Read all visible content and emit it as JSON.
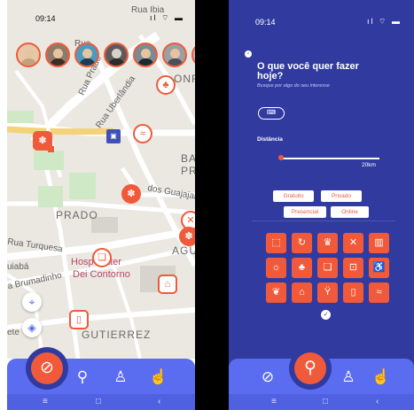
{
  "colors": {
    "accent": "#f05a3a",
    "primary": "#313b9f",
    "nav": "#5a6cf0"
  },
  "map_screen": {
    "status": {
      "time": "09:14",
      "icons": "ıl ⌔ ▬"
    },
    "street_labels": {
      "rua_ibia": "Rua Ibia",
      "rua_top": "Rua",
      "rua_prado": "Rua Prado",
      "rua_uberlandia": "Rua Uberlândia",
      "onfi": "ONFI",
      "ba": "BA",
      "pr": "PR",
      "dos_guajajaras": "dos Guajajar",
      "prado": "PRADO",
      "agu": "AGU",
      "rua_turquesa": "Rua Turquesa",
      "uiaba": "uiabá",
      "brumadinho": "a Brumadinho",
      "hospital": "Hosp  Mater",
      "dei_contorno": "Dei Contorno",
      "gutierrez": "GUTIERREZ",
      "ete": "ete"
    },
    "nav": {
      "explore": "explore-icon",
      "search": "search-icon",
      "profile": "profile-icon",
      "touch": "touch-icon"
    }
  },
  "filter_screen": {
    "status": {
      "time": "09:14",
      "icons": "ıl ⌔ ▬"
    },
    "title": "O que você quer fazer hoje?",
    "subtitle": "Busque por algo do seu interesse",
    "distance_label": "Distância",
    "distance_value": "20km",
    "distance_fraction": 0.02,
    "chips": {
      "gratuito": "Gratuito",
      "privado": "Privado",
      "presencial": "Presencial",
      "online": "Online"
    },
    "categories": [
      "frame-icon",
      "refresh-icon",
      "crown-icon",
      "dining-icon",
      "piano-icon",
      "sun-icon",
      "tree-icon",
      "gallery-icon",
      "shop-icon",
      "accessibility-icon",
      "leaf-icon",
      "museum-icon",
      "bar-icon",
      "door-icon",
      "swim-icon"
    ]
  }
}
